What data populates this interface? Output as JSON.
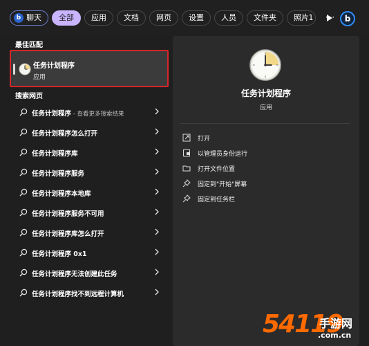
{
  "topbar": {
    "filters": [
      {
        "label": "聊天",
        "kind": "chat"
      },
      {
        "label": "全部",
        "kind": "active"
      },
      {
        "label": "应用",
        "kind": "normal"
      },
      {
        "label": "文档",
        "kind": "normal"
      },
      {
        "label": "网页",
        "kind": "normal"
      },
      {
        "label": "设置",
        "kind": "normal"
      },
      {
        "label": "人员",
        "kind": "normal"
      },
      {
        "label": "文件夹",
        "kind": "normal"
      },
      {
        "label": "照片",
        "kind": "normal"
      }
    ],
    "count": "1",
    "more": "···",
    "bing_logo": "b"
  },
  "left": {
    "best_match_title": "最佳匹配",
    "best_match": {
      "name": "任务计划程序",
      "type": "应用"
    },
    "web_title": "搜索网页",
    "web_results": [
      {
        "text": "任务计划程序",
        "suffix": " - 查看更多搜索结果"
      },
      {
        "text": "任务计划程序怎么打开",
        "suffix": ""
      },
      {
        "text": "任务计划程序库",
        "suffix": ""
      },
      {
        "text": "任务计划程序服务",
        "suffix": ""
      },
      {
        "text": "任务计划程序本地库",
        "suffix": ""
      },
      {
        "text": "任务计划程序服务不可用",
        "suffix": ""
      },
      {
        "text": "任务计划程序库怎么打开",
        "suffix": ""
      },
      {
        "text": "任务计划程序 0x1",
        "suffix": ""
      },
      {
        "text": "任务计划程序无法创建此任务",
        "suffix": ""
      },
      {
        "text": "任务计划程序找不到远程计算机",
        "suffix": ""
      }
    ]
  },
  "right": {
    "app_title": "任务计划程序",
    "app_type": "应用",
    "actions": [
      {
        "label": "打开",
        "icon": "open-icon"
      },
      {
        "label": "以管理员身份运行",
        "icon": "shield-icon"
      },
      {
        "label": "打开文件位置",
        "icon": "folder-icon"
      },
      {
        "label": "固定到\"开始\"屏幕",
        "icon": "pin-icon"
      },
      {
        "label": "固定到任务栏",
        "icon": "pin-icon"
      }
    ]
  },
  "watermark": {
    "number": "54119",
    "cn": "手游网",
    "url": ".com.cn"
  }
}
